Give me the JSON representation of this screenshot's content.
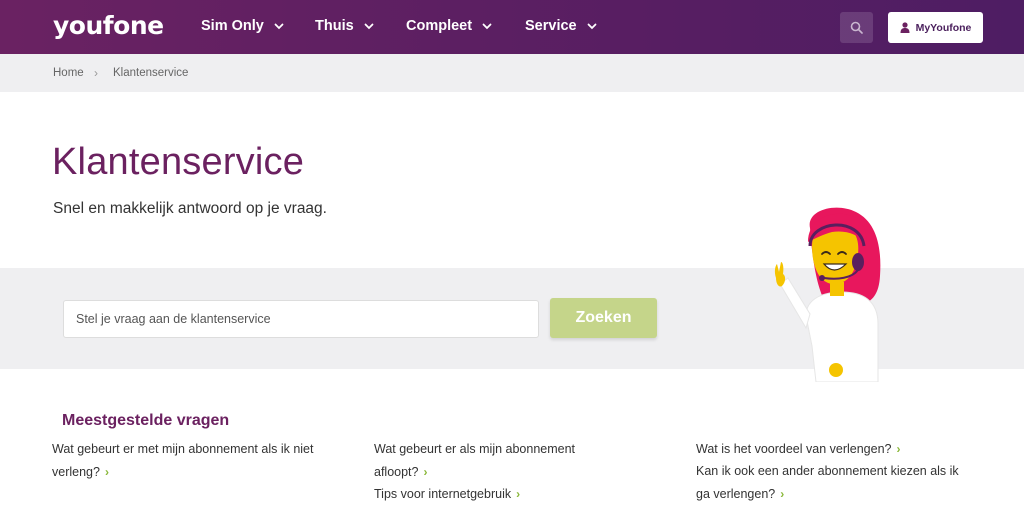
{
  "header": {
    "logo": "youfone",
    "nav": [
      {
        "label": "Sim Only"
      },
      {
        "label": "Thuis"
      },
      {
        "label": "Compleet"
      },
      {
        "label": "Service"
      }
    ],
    "account_label": "MyYoufone",
    "search_icon": "search-icon",
    "account_icon": "user-icon"
  },
  "breadcrumb": {
    "items": [
      "Home",
      "Klantenservice"
    ],
    "separator": "›"
  },
  "hero": {
    "title": "Klantenservice",
    "subtitle": "Snel en makkelijk antwoord op je vraag."
  },
  "search": {
    "placeholder": "Stel je vraag aan de klantenservice",
    "value": "",
    "button_label": "Zoeken"
  },
  "faq": {
    "title": "Meestgestelde vragen",
    "columns": [
      [
        {
          "line1": "Wat gebeurt er met mijn abonnement als ik niet",
          "line2": "verleng?"
        }
      ],
      [
        {
          "line1": "Wat gebeurt er als mijn abonnement",
          "line2": "afloopt?"
        },
        {
          "line1": "Tips voor internetgebruik",
          "line2": ""
        }
      ],
      [
        {
          "line1": "Wat is het voordeel van verlengen?",
          "line2": ""
        },
        {
          "line1": "Kan ik ook een ander abonnement kiezen als ik",
          "line2": "ga verlengen?"
        }
      ]
    ],
    "arrow": "›"
  },
  "colors": {
    "header_purple": "#5c1f62",
    "title_purple": "#6b2160",
    "button_green": "#c5d58a",
    "arrow_green": "#8ab83a",
    "band_grey": "#efeff1"
  }
}
